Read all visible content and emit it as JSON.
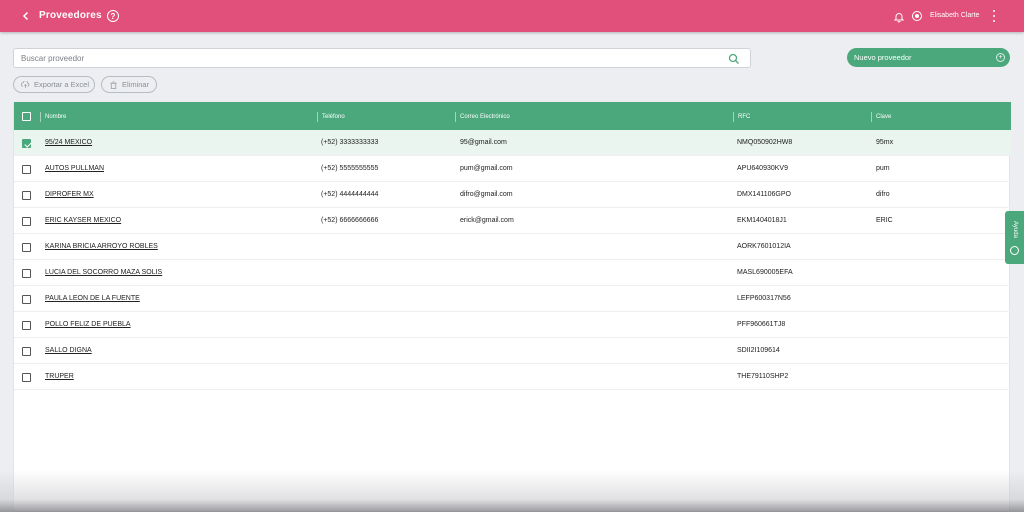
{
  "header": {
    "title": "Proveedores",
    "help_icon": "?",
    "username": "Elisabeth Clarte",
    "color": "#e0507a"
  },
  "toolbar": {
    "search_placeholder": "Buscar proveedor",
    "search_value": "",
    "new_button_label": "Nuevo proveedor",
    "export_label": "Exportar a Excel",
    "delete_label": "Eliminar",
    "accent": "#4aa87c"
  },
  "table": {
    "columns": [
      "Nombre",
      "Teléfono",
      "Correo Electrónico",
      "RFC",
      "Clave"
    ],
    "rows": [
      {
        "name": "95/24 MEXICO",
        "tel": "(+52) 3333333333",
        "mail": "95@gmail.com",
        "rfc": "NMQ050902HW8",
        "clave": "95mx",
        "selected": true
      },
      {
        "name": "AUTOS PULLMAN",
        "tel": "(+52) 5555555555",
        "mail": "pum@gmail.com",
        "rfc": "APU640930KV9",
        "clave": "pum",
        "selected": false
      },
      {
        "name": "DIPROFER MX",
        "tel": "(+52) 4444444444",
        "mail": "difro@gmail.com",
        "rfc": "DMX141106GPO",
        "clave": "difro",
        "selected": false
      },
      {
        "name": "ERIC KAYSER MEXICO",
        "tel": "(+52) 6666666666",
        "mail": "erick@gmail.com",
        "rfc": "EKM1404018J1",
        "clave": "ERIC",
        "selected": false
      },
      {
        "name": "KARINA BRICIA ARROYO ROBLES",
        "tel": "",
        "mail": "",
        "rfc": "AORK7601012IA",
        "clave": "",
        "selected": false
      },
      {
        "name": "LUCIA DEL SOCORRO MAZA SOLIS",
        "tel": "",
        "mail": "",
        "rfc": "MASL690005EFA",
        "clave": "",
        "selected": false
      },
      {
        "name": "PAULA LEON DE LA FUENTE",
        "tel": "",
        "mail": "",
        "rfc": "LEFP600317N56",
        "clave": "",
        "selected": false
      },
      {
        "name": "POLLO FELIZ DE PUEBLA",
        "tel": "",
        "mail": "",
        "rfc": "PFF960661TJ8",
        "clave": "",
        "selected": false
      },
      {
        "name": "SALLO DIGNA",
        "tel": "",
        "mail": "",
        "rfc": "SDII2I109614",
        "clave": "",
        "selected": false
      },
      {
        "name": "TRUPER",
        "tel": "",
        "mail": "",
        "rfc": "THE79110SHP2",
        "clave": "",
        "selected": false
      }
    ]
  },
  "side_tab": {
    "label": "Ayuda"
  }
}
